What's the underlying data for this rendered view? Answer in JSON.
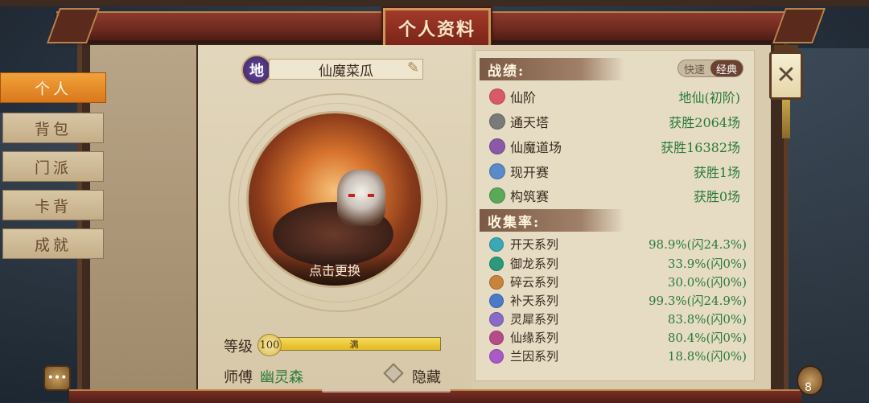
{
  "header": {
    "title": "个人资料"
  },
  "sidebar": {
    "items": [
      {
        "label": "个人",
        "active": true
      },
      {
        "label": "背包",
        "active": false
      },
      {
        "label": "门派",
        "active": false
      },
      {
        "label": "卡背",
        "active": false
      },
      {
        "label": "成就",
        "active": false
      }
    ]
  },
  "profile": {
    "rank_badge": "地",
    "name": "仙魔菜瓜",
    "avatar_label": "点击更换",
    "level_label": "等级",
    "level_value": "100",
    "level_max_text": "满",
    "level_progress": 1.0,
    "master_label": "师傅",
    "master_name": "幽灵森",
    "hide_label": "隐藏"
  },
  "stats": {
    "title": "战绩:",
    "toggle": {
      "off_label": "快速",
      "on_label": "经典"
    },
    "rows": [
      {
        "label": "仙阶",
        "value": "地仙(初阶)",
        "icon": "star-icon",
        "color": "#d85a6a"
      },
      {
        "label": "通天塔",
        "value": "获胜2064场",
        "icon": "tower-icon",
        "color": "#7a7a7a"
      },
      {
        "label": "仙魔道场",
        "value": "获胜16382场",
        "icon": "arena-icon",
        "color": "#8a5aa8"
      },
      {
        "label": "现开赛",
        "value": "获胜1场",
        "icon": "sealed-icon",
        "color": "#5a8ac8"
      },
      {
        "label": "构筑赛",
        "value": "获胜0场",
        "icon": "build-icon",
        "color": "#5aa85a"
      }
    ]
  },
  "collection": {
    "title": "收集率:",
    "rows": [
      {
        "label": "开天系列",
        "value": "98.9%(闪24.3%)",
        "icon": "kaitian-icon",
        "color": "#3aa8b8"
      },
      {
        "label": "御龙系列",
        "value": "33.9%(闪0%)",
        "icon": "yulong-icon",
        "color": "#2a9a7a"
      },
      {
        "label": "碎云系列",
        "value": "30.0%(闪0%)",
        "icon": "suiyun-icon",
        "color": "#c8843a"
      },
      {
        "label": "补天系列",
        "value": "99.3%(闪24.9%)",
        "icon": "butian-icon",
        "color": "#4a7ac8"
      },
      {
        "label": "灵犀系列",
        "value": "83.8%(闪0%)",
        "icon": "lingxi-icon",
        "color": "#8a6ac8"
      },
      {
        "label": "仙缘系列",
        "value": "80.4%(闪0%)",
        "icon": "xianyuan-icon",
        "color": "#b84a8a"
      },
      {
        "label": "兰因系列",
        "value": "18.8%(闪0%)",
        "icon": "lanyin-icon",
        "color": "#a85ac8"
      }
    ]
  },
  "close": {
    "icon": "close-icon",
    "glyph": "✕"
  },
  "chat": {
    "icon": "chat-icon",
    "glyph": "•••"
  },
  "bag": {
    "icon": "bag-icon",
    "count": "8"
  }
}
